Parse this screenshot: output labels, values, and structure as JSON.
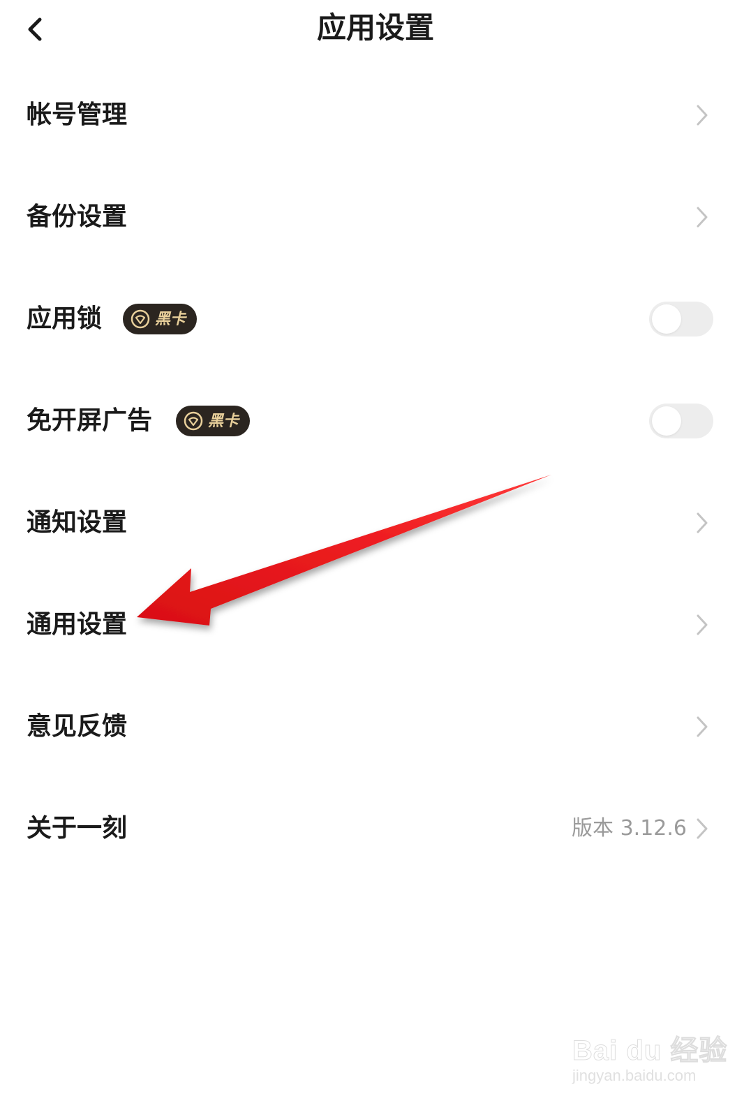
{
  "header": {
    "title": "应用设置",
    "back_icon": "chevron-left-icon"
  },
  "settings": {
    "items": [
      {
        "label": "帐号管理",
        "control": "chevron"
      },
      {
        "label": "备份设置",
        "control": "chevron"
      },
      {
        "label": "应用锁",
        "control": "toggle",
        "toggle_on": false,
        "badge": "黑卡",
        "badge_icon": "vip-shield-icon"
      },
      {
        "label": "免开屏广告",
        "control": "toggle",
        "toggle_on": false,
        "badge": "黑卡",
        "badge_icon": "vip-shield-icon"
      },
      {
        "label": "通知设置",
        "control": "chevron"
      },
      {
        "label": "通用设置",
        "control": "chevron"
      },
      {
        "label": "意见反馈",
        "control": "chevron"
      },
      {
        "label": "关于一刻",
        "control": "chevron",
        "value": "版本 3.12.6"
      }
    ]
  },
  "annotation": {
    "arrow_color": "#e8191c",
    "arrow_target": "通用设置"
  },
  "watermark": {
    "logo_text": "Bai du 经验",
    "url": "jingyan.baidu.com"
  },
  "colors": {
    "badge_bg": "#2b2520",
    "badge_text": "#e8cf9a",
    "toggle_off": "#ededed",
    "secondary_text": "#9a9a9a",
    "chevron": "#c4c4c4"
  }
}
